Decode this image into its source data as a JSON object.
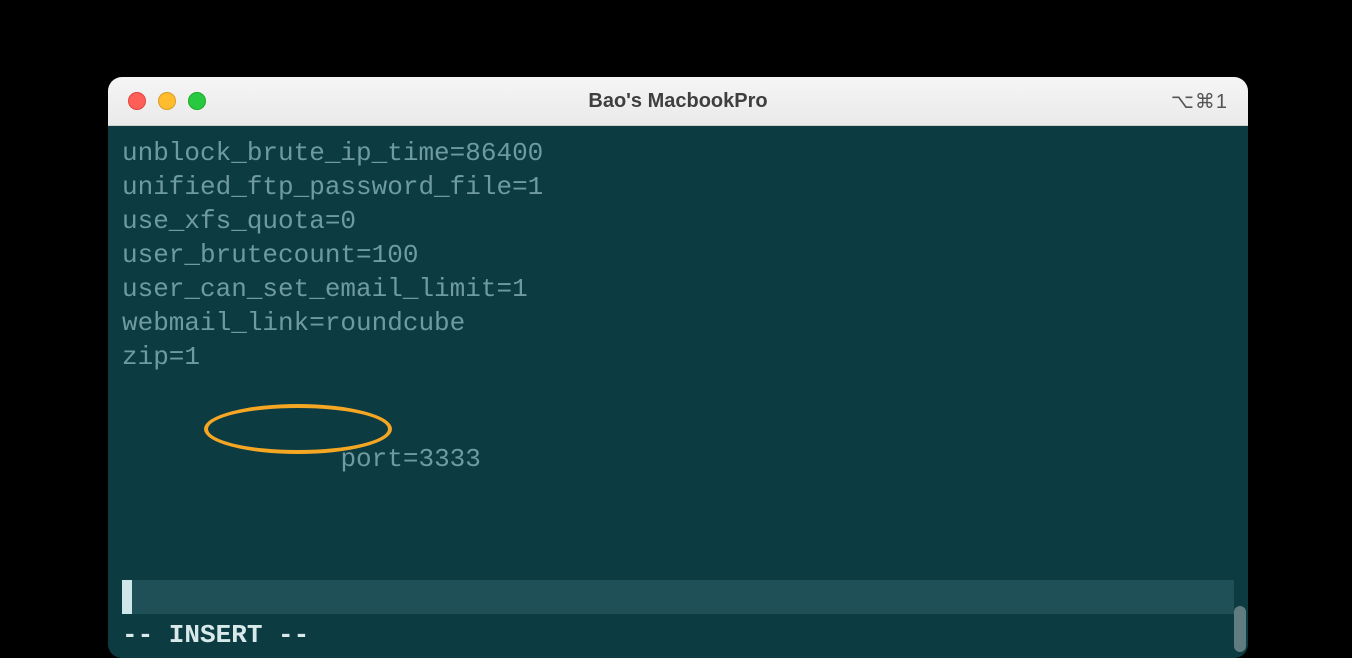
{
  "window": {
    "title": "Bao's MacbookPro",
    "shortcut_indicator": "⌥⌘1"
  },
  "editor": {
    "lines": [
      "unblock_brute_ip_time=86400",
      "unified_ftp_password_file=1",
      "use_xfs_quota=0",
      "user_brutecount=100",
      "user_can_set_email_limit=1",
      "webmail_link=roundcube",
      "zip=1"
    ],
    "highlighted_line": "port=3333",
    "mode_line": "-- INSERT --"
  },
  "colors": {
    "terminal_bg": "#0c3b42",
    "terminal_fg": "#6f9aa0",
    "highlight_border": "#f5a623",
    "cursor_line_bg": "#1f5058"
  }
}
